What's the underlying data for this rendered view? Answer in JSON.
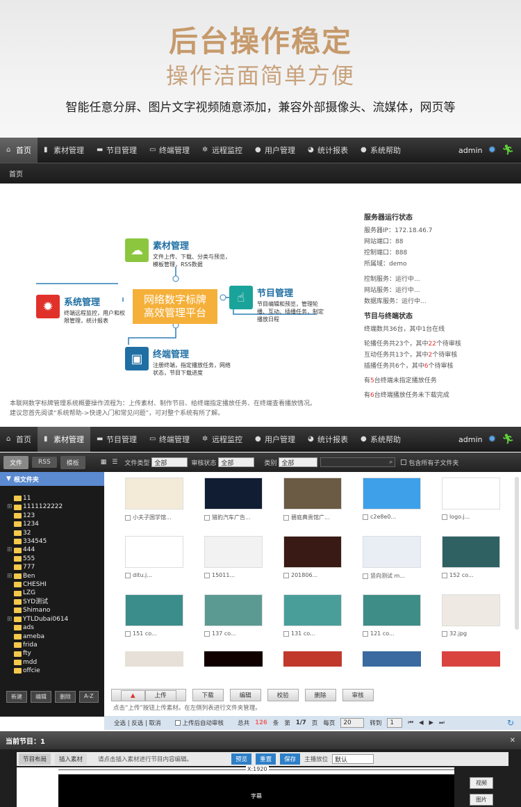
{
  "hero": {
    "title": "后台操作稳定",
    "subtitle": "操作洁面简单方便",
    "desc": "智能任意分屏、图片文字视频随意添加，兼容外部摄像头、流媒体，网页等"
  },
  "nav": {
    "items": [
      "首页",
      "素材管理",
      "节目管理",
      "终端管理",
      "远程监控",
      "用户管理",
      "统计报表",
      "系统帮助"
    ],
    "user": "admin"
  },
  "breadcrumb": "首页",
  "dash": {
    "center": [
      "网络数字标牌",
      "高效管理平台"
    ],
    "modules": [
      {
        "title": "素材管理",
        "desc": "文件上传、下载、分类与预览，模板管理，RSS数据"
      },
      {
        "title": "系统管理",
        "desc": "终端远程监控，用户和权限管理，统计报表"
      },
      {
        "title": "节目管理",
        "desc": "节目编辑和预览，管理轮播、互动、插播任务，制定播放日程"
      },
      {
        "title": "终端管理",
        "desc": "注册终端，指定播放任务，网络状态，节目下载进度"
      }
    ],
    "status": {
      "h1": "服务器运行状态",
      "lines1": [
        "服务器IP：172.18.46.7",
        "网站端口：88",
        "控制端口：888",
        "所属域：demo"
      ],
      "lines2": [
        "控制服务：运行中...",
        "网站服务：运行中...",
        "数据库服务：运行中..."
      ],
      "h2": "节目与终端状态",
      "l1": "终端数共36台，其中1台在线",
      "l2a": "轮播任务共23个，其中",
      "l2b": "22",
      "l2c": "个待审核",
      "l3a": "互动任务共13个，其中",
      "l3b": "2",
      "l3c": "个待审核",
      "l4a": "插播任务共6个，其中",
      "l4b": "6",
      "l4c": "个待审核",
      "l5a": "有",
      "l5b": "5",
      "l5c": "台终端未指定播放任务",
      "l6a": "有",
      "l6b": "6",
      "l6c": "台终端播放任务未下载完成"
    },
    "note1": "本联网数字标牌管理系统概要操作流程为：上传素材、制作节目、给终端指定播放任务、在终端查看播放情况。",
    "note2": "建议您首先阅读“系统帮助->快速入门和常见问题”，可对整个系统有所了解。"
  },
  "filebar": {
    "tabs": [
      "文件",
      "RSS",
      "模板"
    ],
    "type_label": "文件类型",
    "type_val": "全部",
    "audit_label": "审核状态",
    "audit_val": "全部",
    "cat_label": "类别",
    "cat_val": "全部",
    "include_sub": "包含所有子文件夹"
  },
  "tree": {
    "root": "根文件夹",
    "items": [
      "11",
      "1111122222",
      "123",
      "1234",
      "32",
      "334545",
      "444",
      "555",
      "777",
      "Ben",
      "CHESHI",
      "LZG",
      "SYD测试",
      "Shimano",
      "YTLDubai0614",
      "ads",
      "ameba",
      "frida",
      "fty",
      "mdd",
      "offcie"
    ],
    "buttons": [
      "新建",
      "编辑",
      "删除",
      "A-Z"
    ]
  },
  "files": [
    "小夫子国学馆...",
    "猎豹汽车广告...",
    "碧庭典贵馆广...",
    "c2e8e0...",
    "logo.j...",
    "ditu.j...",
    "15011...",
    "201806...",
    "竖向测试 m...",
    "152 co...",
    "151 co...",
    "137 co...",
    "131 co...",
    "121 co...",
    "32.jpg"
  ],
  "actions": [
    "上传",
    "下载",
    "编辑",
    "校验",
    "删除",
    "审核"
  ],
  "hint": "点击“上传”按钮上传素材。在左侧列表进行文件夹管理。",
  "pager": {
    "select": "全选 | 反选 | 取消",
    "autocheck": "上传后自动审核",
    "total_a": "总共",
    "total": "126",
    "total_b": "条",
    "page_a": "第",
    "page": "1/7",
    "page_b": "页",
    "per_a": "每页",
    "per": "20",
    "goto": "转到",
    "goto_val": "1"
  },
  "program": {
    "title": "当前节目：1",
    "tabs": [
      "节目布局",
      "插入素材"
    ],
    "hint": "请点击插入素材进行节目内容编辑。",
    "btns": [
      "预览",
      "重置",
      "保存"
    ],
    "pos_label": "主播放位",
    "pos_val": "默认",
    "ruler": "X:1920",
    "subtitle": "字幕",
    "side_btns": [
      "视频",
      "图片"
    ]
  }
}
